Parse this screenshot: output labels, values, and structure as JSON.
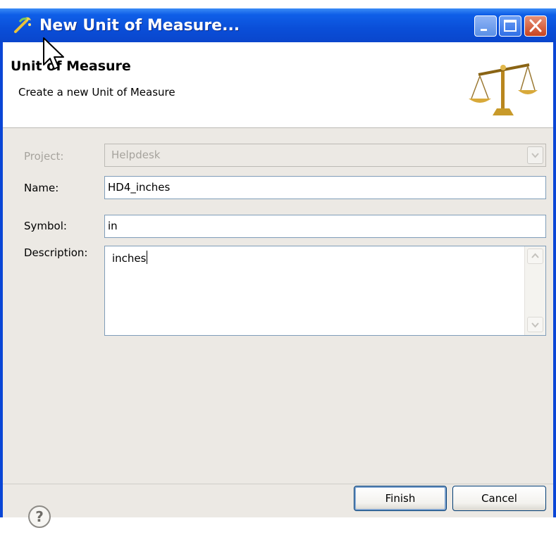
{
  "window": {
    "title": "New Unit of Measure...",
    "controls": [
      "minimize-icon",
      "maximize-icon",
      "close-icon"
    ]
  },
  "banner": {
    "title": "Unit of Measure",
    "description": "Create a new Unit of Measure",
    "icon": "balance-scale-icon"
  },
  "form": {
    "project": {
      "label": "Project:",
      "value": "Helpdesk",
      "enabled": false
    },
    "name": {
      "label": "Name:",
      "value": "HD4_inches"
    },
    "symbol": {
      "label": "Symbol:",
      "value": "in"
    },
    "description": {
      "label": "Description:",
      "value": "inches"
    }
  },
  "footer": {
    "help_icon": "help-question-icon",
    "finish_label": "Finish",
    "cancel_label": "Cancel"
  },
  "colors": {
    "titlebar": "#0a4ed8",
    "dialog_bg": "#ece9e4",
    "field_border": "#7f9db9",
    "disabled_text": "#a6a39d"
  }
}
